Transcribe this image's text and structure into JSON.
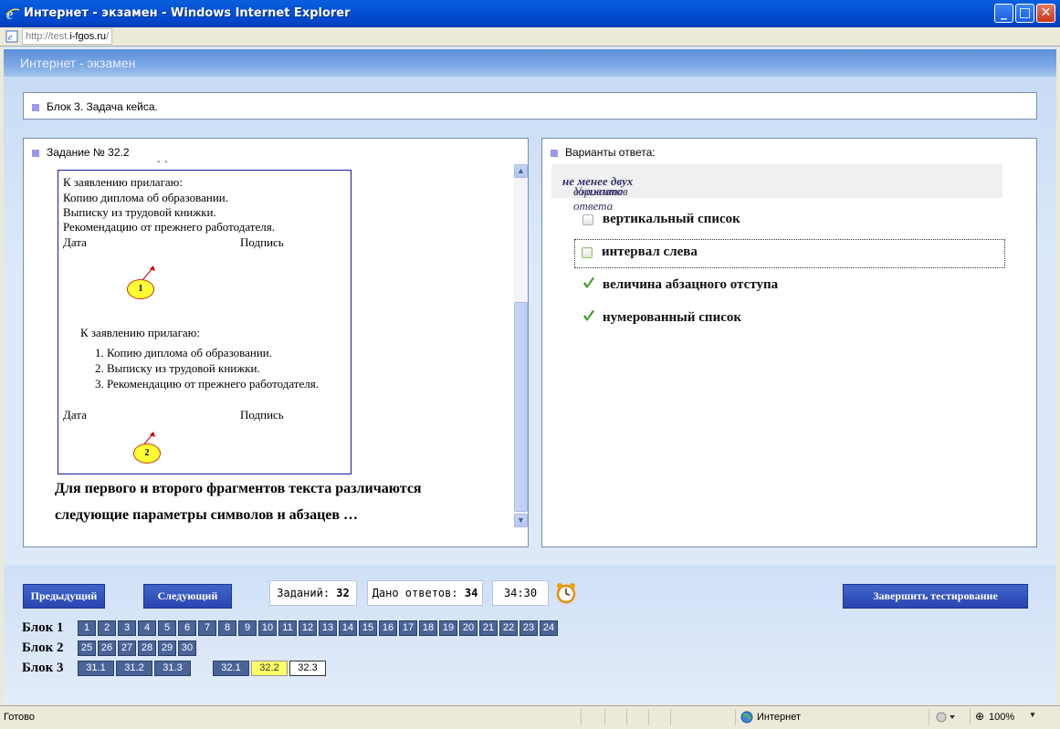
{
  "window": {
    "title": "Интернет - экзамен - Windows Internet Explorer",
    "url_prefix": "http://test.",
    "url_domain": "i-fgos.ru",
    "url_suffix": "/"
  },
  "header": {
    "title": "Интернет - экзамен"
  },
  "block_bar": {
    "label": "Блок 3. Задача кейса."
  },
  "task": {
    "label": "Задание № 32.2",
    "fragment1": [
      "К заявлению прилагаю:",
      "Копию диплома об образовании.",
      "Выписку из трудовой книжки.",
      "Рекомендацию от прежнего работодателя."
    ],
    "date_label": "Дата",
    "sign_label": "Подпись",
    "oval1": "1",
    "fragment2_heading": "К заявлению прилагаю:",
    "fragment2": [
      "1.  Копию диплома об образовании.",
      "2.  Выписку из трудовой книжки.",
      "3.  Рекомендацию от прежнего работодателя."
    ],
    "date_label2": "Дата",
    "sign_label2": "Подпись",
    "oval2": "2",
    "question_line1": "Для первого и второго фрагментов текста различаются",
    "question_line2": "следующие параметры символов и абзацев …"
  },
  "answers": {
    "label": "Варианты ответа:",
    "hint_prefix": "Укажите ",
    "hint_bold": "не менее двух",
    "hint_suffix": " вариантов ответа",
    "options": [
      {
        "label": "вертикальный список",
        "checked": false
      },
      {
        "label": "интервал слева",
        "checked": false
      },
      {
        "label": "величина абзацного отступа",
        "checked": true
      },
      {
        "label": "нумерованный список",
        "checked": true
      }
    ]
  },
  "nav": {
    "prev": "Предыдущий",
    "next": "Следующий",
    "tasks_label": "Заданий:",
    "tasks_count": "32",
    "answered_label": "Дано ответов:",
    "answered_count": "34",
    "timer": "34:30",
    "finish": "Завершить тестирование"
  },
  "blocks": [
    {
      "label": "Блок 1",
      "items": [
        "1",
        "2",
        "3",
        "4",
        "5",
        "6",
        "7",
        "8",
        "9",
        "10",
        "11",
        "12",
        "13",
        "14",
        "15",
        "16",
        "17",
        "18",
        "19",
        "20",
        "21",
        "22",
        "23",
        "24"
      ]
    },
    {
      "label": "Блок 2",
      "items": [
        "25",
        "26",
        "27",
        "28",
        "29",
        "30"
      ]
    },
    {
      "label": "Блок 3",
      "items": [
        "31.1",
        "31.2",
        "31.3",
        "32.1",
        "32.2",
        "32.3"
      ]
    }
  ],
  "status": {
    "left": "Готово",
    "zone": "Интернет",
    "zoom": "100%"
  },
  "colors": {
    "titlebar": "#0451d6",
    "accent_bullet": "#9999ee",
    "question_button": "#4a6498",
    "current_question": "#ffff66",
    "checkmark": "#3a9a1a"
  }
}
